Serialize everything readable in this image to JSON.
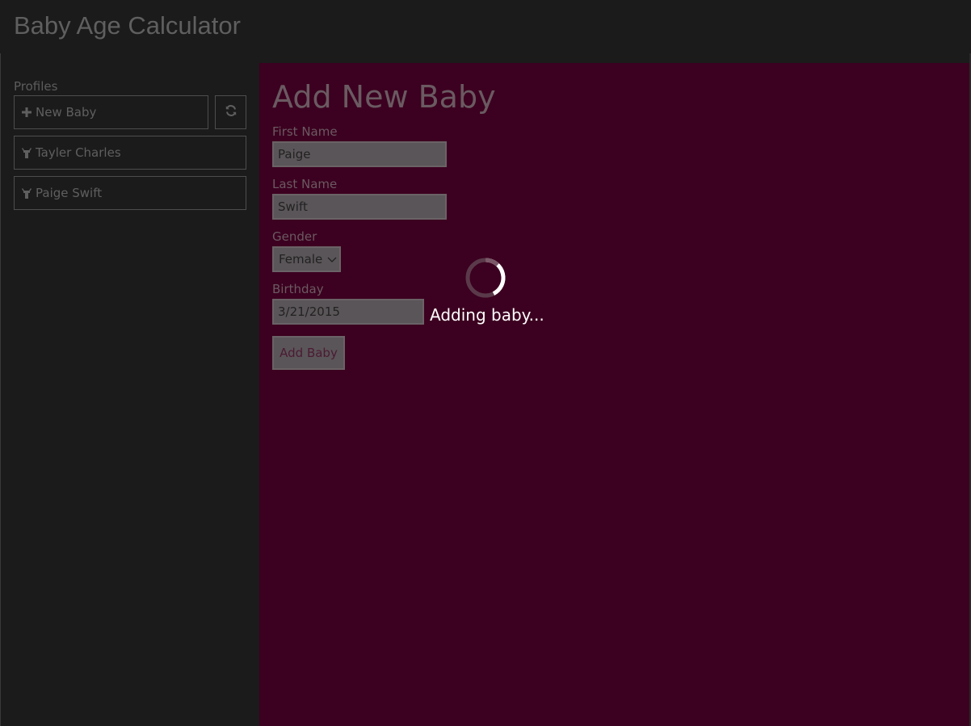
{
  "app": {
    "title": "Baby Age Calculator"
  },
  "sidebar": {
    "section_label": "Profiles",
    "new_button_label": "New Baby",
    "refresh_icon": "refresh-icon",
    "items": [
      {
        "label": "Tayler Charles",
        "icon": "baby-icon"
      },
      {
        "label": "Paige Swift",
        "icon": "baby-icon"
      }
    ]
  },
  "form": {
    "title": "Add New Baby",
    "first_name": {
      "label": "First Name",
      "value": "Paige"
    },
    "last_name": {
      "label": "Last Name",
      "value": "Swift"
    },
    "gender": {
      "label": "Gender",
      "value": "Female"
    },
    "birthday": {
      "label": "Birthday",
      "value": "3/21/2015"
    },
    "submit_label": "Add Baby"
  },
  "loading": {
    "text": "Adding baby..."
  },
  "colors": {
    "chrome_bg": "#1b1b1b",
    "main_bg": "#3c0020",
    "text_dim": "#5f5f5f",
    "loading_text": "#ffffff"
  }
}
